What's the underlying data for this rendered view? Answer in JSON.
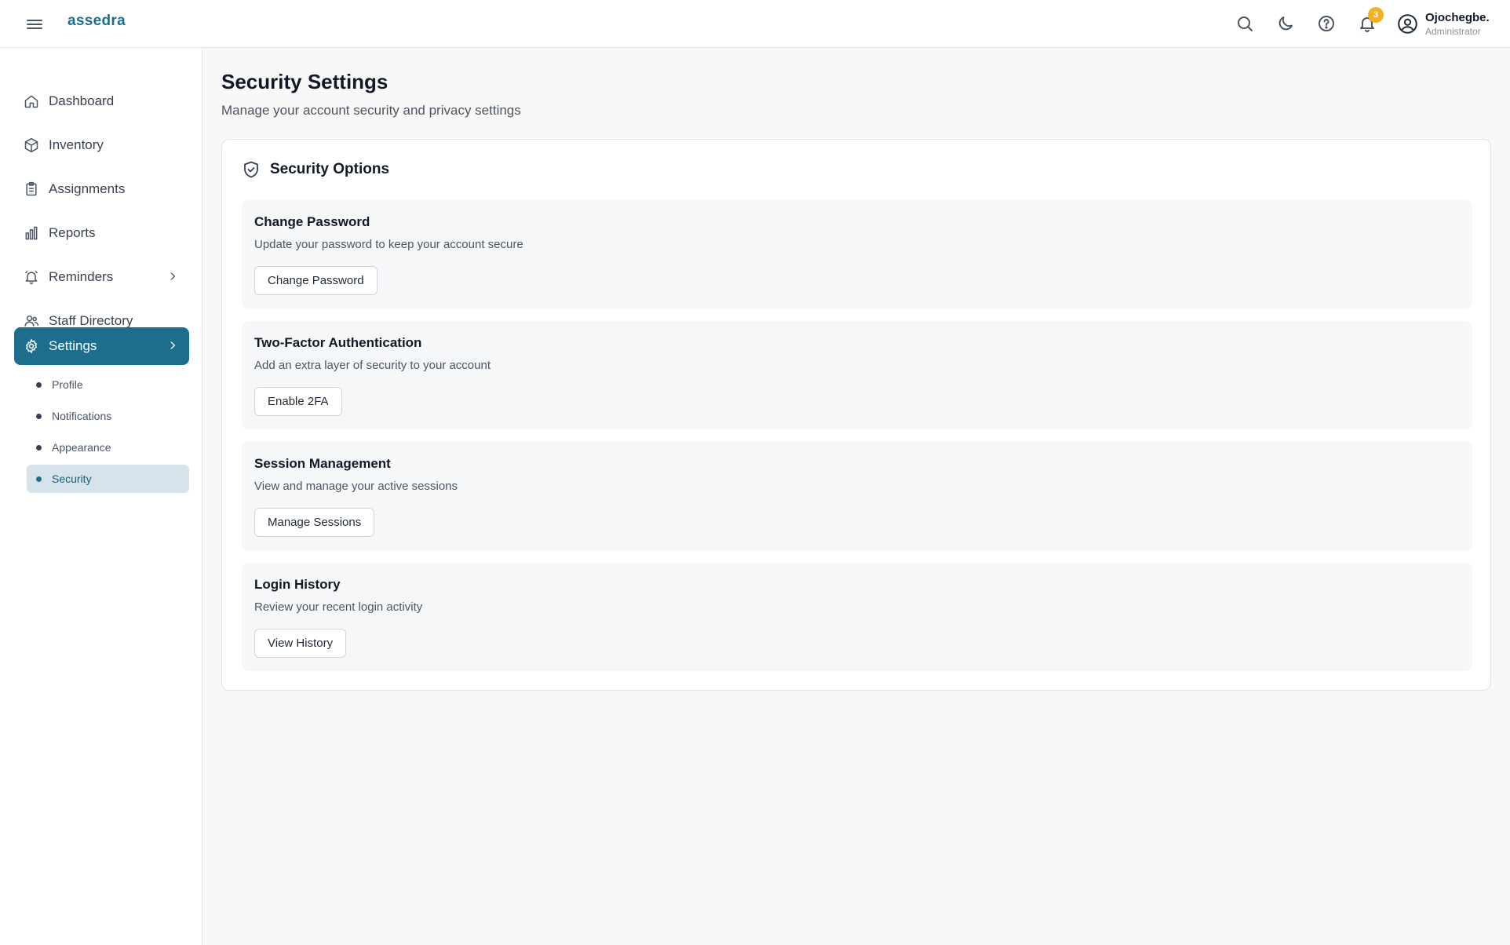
{
  "app": {
    "brand": "assedra"
  },
  "header": {
    "notification_count": "3",
    "user": {
      "name": "Ojochegbe.",
      "role": "Administrator"
    },
    "icons": [
      "menu-icon",
      "search-icon",
      "moon-icon",
      "help-icon",
      "bell-icon",
      "user-circle-icon"
    ]
  },
  "sidebar": {
    "items": [
      {
        "label": "Dashboard",
        "icon": "home-icon"
      },
      {
        "label": "Inventory",
        "icon": "box-icon"
      },
      {
        "label": "Assignments",
        "icon": "clipboard-icon"
      },
      {
        "label": "Reports",
        "icon": "bar-chart-icon"
      },
      {
        "label": "Reminders",
        "icon": "alarm-icon"
      },
      {
        "label": "Staff Directory",
        "icon": "users-icon"
      },
      {
        "label": "Settings",
        "icon": "gear-icon"
      }
    ],
    "settings_sub": [
      "Profile",
      "Notifications",
      "Appearance",
      "Security"
    ]
  },
  "page": {
    "title": "Security Settings",
    "subtitle": "Manage your account security and privacy settings"
  },
  "card": {
    "title": "Security Options",
    "sections": [
      {
        "title": "Change Password",
        "description": "Update your password to keep your account secure",
        "button": "Change Password"
      },
      {
        "title": "Two-Factor Authentication",
        "description": "Add an extra layer of security to your account",
        "button": "Enable 2FA"
      },
      {
        "title": "Session Management",
        "description": "View and manage your active sessions",
        "button": "Manage Sessions"
      },
      {
        "title": "Login History",
        "description": "Review your recent login activity",
        "button": "View History"
      }
    ]
  },
  "colors": {
    "accent": "#1d6e8c",
    "badge": "#f5b021",
    "active_sub_bg": "#d6e3ea"
  }
}
